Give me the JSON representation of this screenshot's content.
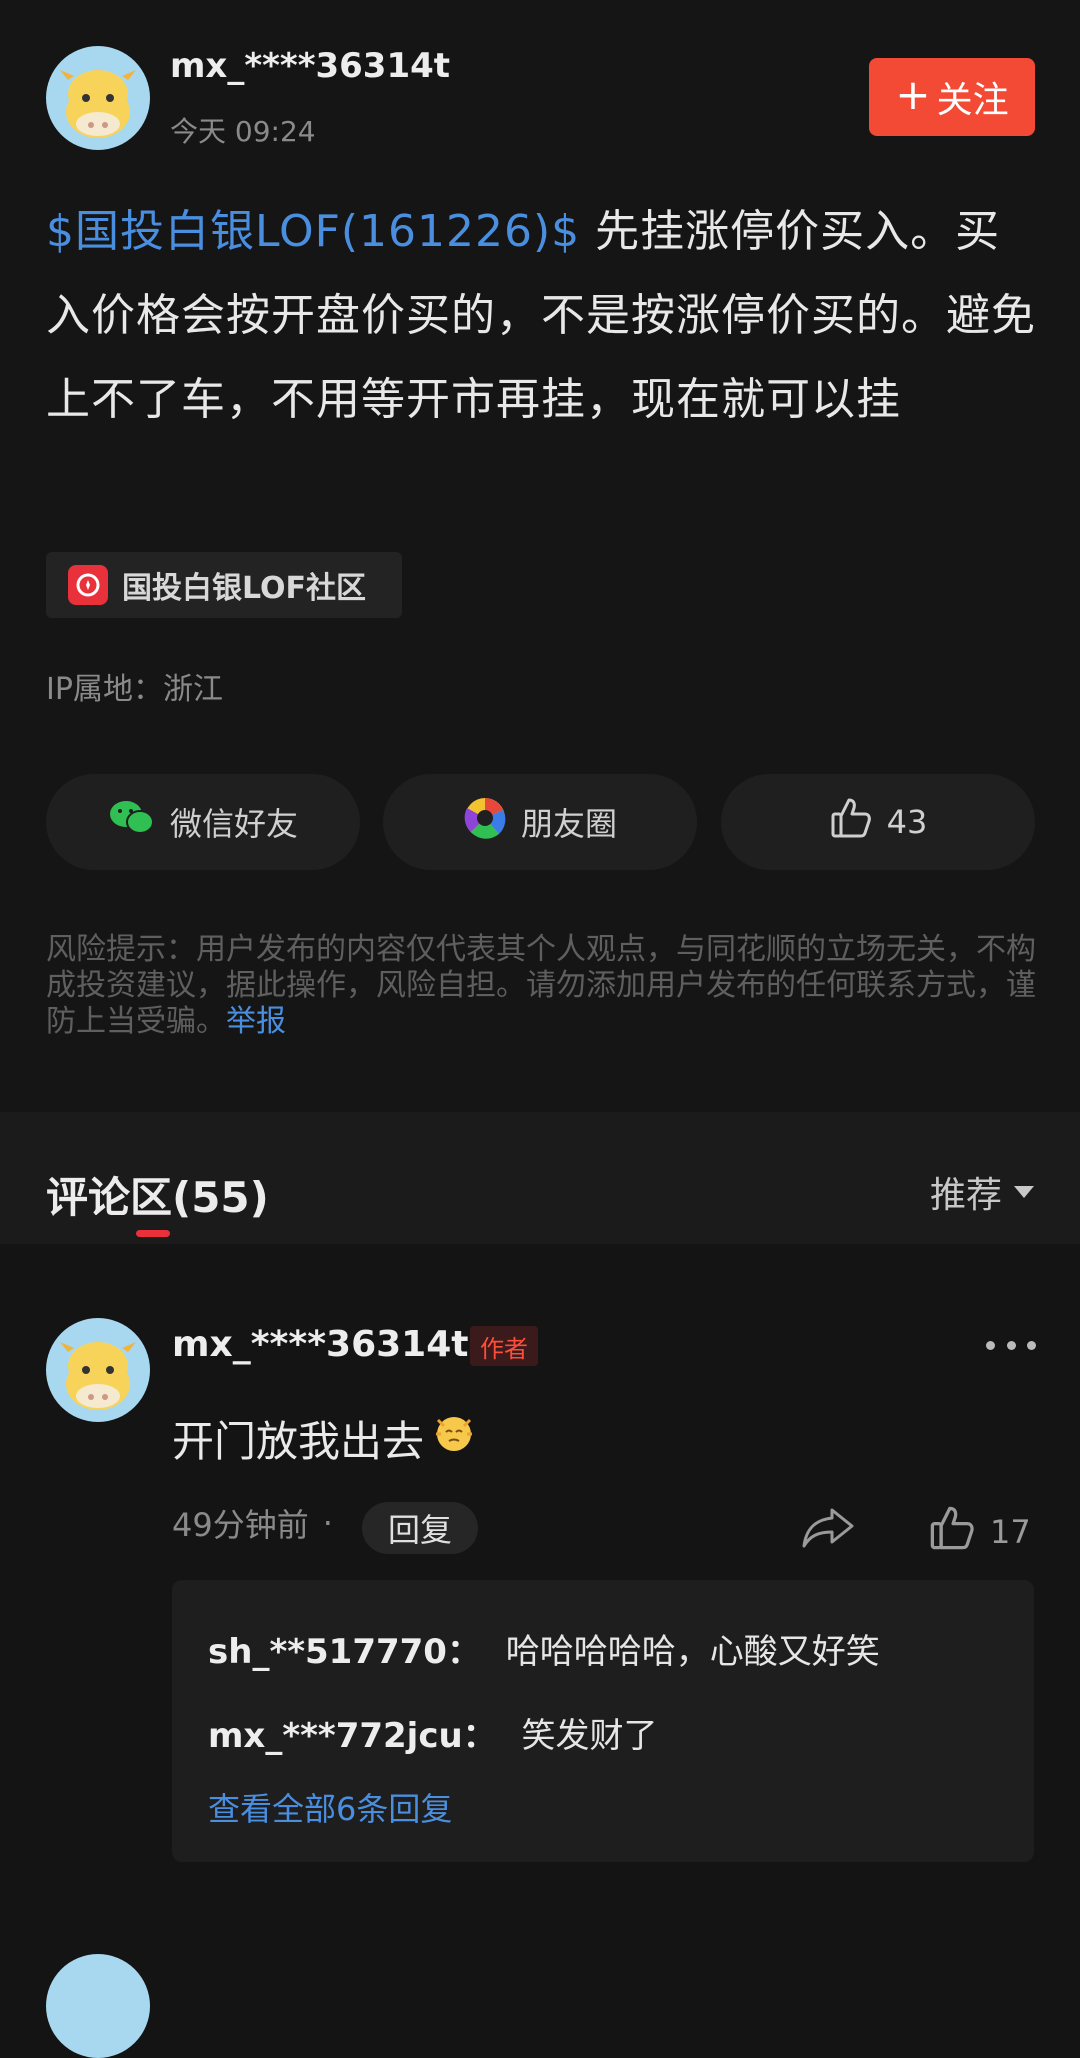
{
  "post": {
    "author": "mx_****36314t",
    "time": "今天 09:24",
    "follow_label": "关注",
    "follow_plus": "+",
    "stock_tag": "$国投白银LOF(161226)$",
    "content": " 先挂涨停价买入。买入价格会按开盘价买的，不是按涨停价买的。避免上不了车，不用等开市再挂，现在就可以挂",
    "community": "国投白银LOF社区",
    "ip": "IP属地：浙江",
    "share": {
      "wechat_label": "微信好友",
      "moments_label": "朋友圈",
      "like_count": "43"
    },
    "risk_text": "风险提示：用户发布的内容仅代表其个人观点，与同花顺的立场无关，不构成投资建议，据此操作，风险自担。请勿添加用户发布的任何联系方式，谨防上当受骗。",
    "report_label": "举报"
  },
  "comments_section": {
    "title": "评论区(55)",
    "sort_label": "推荐"
  },
  "comment": {
    "author": "mx_****36314t",
    "badge": "作者",
    "text": "开门放我出去",
    "time": "49分钟前",
    "dot": "·",
    "reply_label": "回复",
    "like_count": "17",
    "replies": [
      {
        "user": "sh_**517770：",
        "text": "哈哈哈哈哈，心酸又好笑"
      },
      {
        "user": "mx_***772jcu：",
        "text": "笑发财了"
      }
    ],
    "view_all_label": "查看全部6条回复"
  },
  "colors": {
    "accent_red": "#f24a35",
    "link_blue": "#4a8ee0",
    "background": "#141414"
  },
  "icons": [
    "cow-avatar",
    "wechat-icon",
    "moments-icon",
    "thumbs-up-icon",
    "share-arrow-icon",
    "more-icon",
    "emoji-icon",
    "community-icon"
  ]
}
